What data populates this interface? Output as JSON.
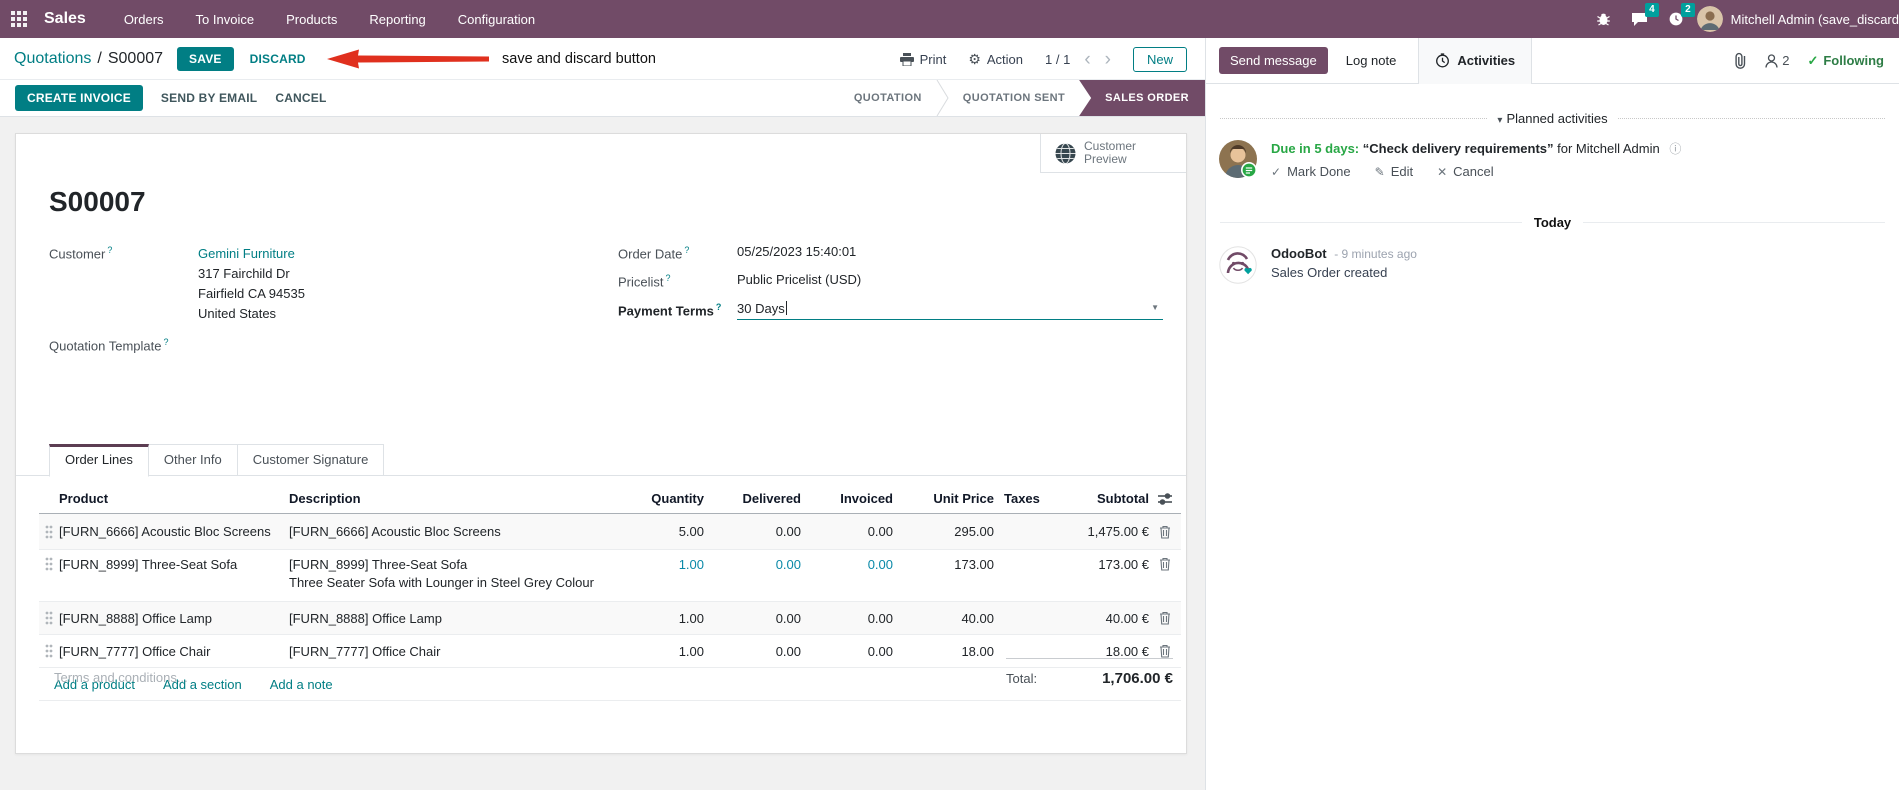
{
  "colors": {
    "brand_purple": "#714B67",
    "accent_teal": "#017E84",
    "badge_teal": "#00A09D",
    "success_green": "#28a745",
    "annotation_red": "#e0301e",
    "edited_value_blue": "#0a89a8"
  },
  "icons": {
    "gear": "⚙",
    "caret_down": "▼",
    "section_caret": "▾",
    "pager_prev": "‹",
    "pager_next": "›",
    "check": "✓",
    "times": "✕",
    "pencil": "✎",
    "info": "ⓘ"
  },
  "nav": {
    "app_name": "Sales",
    "menus": [
      "Orders",
      "To Invoice",
      "Products",
      "Reporting",
      "Configuration"
    ],
    "messages_badge": "4",
    "activities_badge": "2",
    "user_name": "Mitchell Admin (save_discard"
  },
  "control_panel": {
    "breadcrumb_parent": "Quotations",
    "breadcrumb_sep": "/",
    "breadcrumb_current": "S00007",
    "save_label": "SAVE",
    "discard_label": "DISCARD",
    "annotation": "save and discard button",
    "print_label": "Print",
    "action_label": "Action",
    "pager_value": "1 / 1",
    "new_label": "New"
  },
  "statusbar": {
    "create_invoice": "CREATE INVOICE",
    "send_by_email": "SEND BY EMAIL",
    "cancel": "CANCEL",
    "stages": [
      "QUOTATION",
      "QUOTATION SENT",
      "SALES ORDER"
    ],
    "active_stage": "SALES ORDER"
  },
  "form": {
    "customer_preview_label": "Customer Preview",
    "title": "S00007",
    "help_marker": "?",
    "customer_label": "Customer",
    "customer_name": "Gemini Furniture",
    "address_lines": [
      "317 Fairchild Dr",
      "Fairfield CA 94535",
      "United States"
    ],
    "quotation_template_label": "Quotation Template",
    "order_date_label": "Order Date",
    "order_date": "05/25/2023 15:40:01",
    "pricelist_label": "Pricelist",
    "pricelist": "Public Pricelist (USD)",
    "payment_terms_label": "Payment Terms",
    "payment_terms": "30 Days",
    "tabs": [
      "Order Lines",
      "Other Info",
      "Customer Signature"
    ],
    "table": {
      "headers": [
        "Product",
        "Description",
        "Quantity",
        "Delivered",
        "Invoiced",
        "Unit Price",
        "Taxes",
        "Subtotal"
      ],
      "rows": [
        {
          "product": "[FURN_6666] Acoustic Bloc Screens",
          "description": "[FURN_6666] Acoustic Bloc Screens",
          "description2": "",
          "quantity": "5.00",
          "delivered": "0.00",
          "invoiced": "0.00",
          "unit_price": "295.00",
          "taxes": "",
          "subtotal": "1,475.00 €"
        },
        {
          "product": "[FURN_8999] Three-Seat Sofa",
          "description": "[FURN_8999] Three-Seat Sofa",
          "description2": "Three Seater Sofa with Lounger in Steel Grey Colour",
          "quantity": "1.00",
          "delivered": "0.00",
          "invoiced": "0.00",
          "unit_price": "173.00",
          "taxes": "",
          "subtotal": "173.00 €"
        },
        {
          "product": "[FURN_8888] Office Lamp",
          "description": "[FURN_8888] Office Lamp",
          "description2": "",
          "quantity": "1.00",
          "delivered": "0.00",
          "invoiced": "0.00",
          "unit_price": "40.00",
          "taxes": "",
          "subtotal": "40.00 €"
        },
        {
          "product": "[FURN_7777] Office Chair",
          "description": "[FURN_7777] Office Chair",
          "description2": "",
          "quantity": "1.00",
          "delivered": "0.00",
          "invoiced": "0.00",
          "unit_price": "18.00",
          "taxes": "",
          "subtotal": "18.00 €"
        }
      ],
      "add_links": [
        "Add a product",
        "Add a section",
        "Add a note"
      ]
    },
    "terms_placeholder": "Terms and conditions...",
    "total_label": "Total:",
    "total_value": "1,706.00 €"
  },
  "chatter": {
    "send_message": "Send message",
    "log_note": "Log note",
    "activities": "Activities",
    "followers_count": "2",
    "following": "Following",
    "planned_activities": "Planned activities",
    "activity": {
      "due": "Due in 5 days:",
      "summary": "“Check delivery requirements”",
      "for_text": "for Mitchell Admin",
      "mark_done": "Mark Done",
      "edit": "Edit",
      "cancel": "Cancel"
    },
    "today": "Today",
    "message": {
      "author": "OdooBot",
      "time": "- 9 minutes ago",
      "body": "Sales Order created"
    }
  }
}
